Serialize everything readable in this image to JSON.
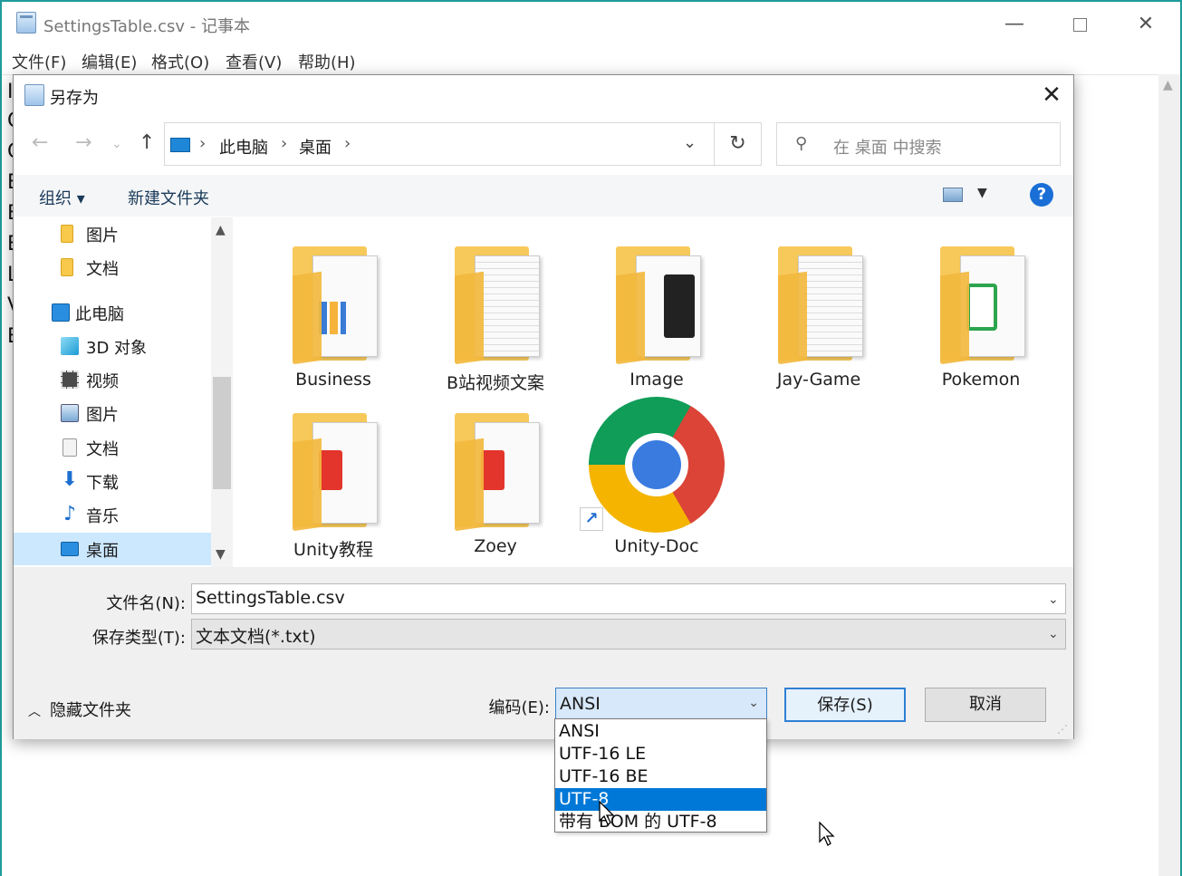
{
  "notepad": {
    "title": "SettingsTable.csv - 记事本",
    "menu": [
      "文件(F)",
      "编辑(E)",
      "格式(O)",
      "查看(V)",
      "帮助(H)"
    ],
    "line_starts": [
      "I",
      "C",
      "C",
      "E",
      "E",
      "E",
      "L",
      "V",
      "E"
    ]
  },
  "dialog": {
    "title": "另存为",
    "address": {
      "segments": [
        "此电脑",
        "桌面"
      ]
    },
    "search_placeholder": "在 桌面 中搜索",
    "toolbar": {
      "organize": "组织 ▾",
      "new_folder": "新建文件夹"
    },
    "nav_items": [
      {
        "label": "图片",
        "icon": "folder-icon"
      },
      {
        "label": "文档",
        "icon": "folder-icon"
      },
      {
        "label": "此电脑",
        "icon": "computer-icon"
      },
      {
        "label": "3D 对象",
        "icon": "3d-objects-icon"
      },
      {
        "label": "视频",
        "icon": "video-icon"
      },
      {
        "label": "图片",
        "icon": "pictures-icon"
      },
      {
        "label": "文档",
        "icon": "documents-icon"
      },
      {
        "label": "下载",
        "icon": "download-icon"
      },
      {
        "label": "音乐",
        "icon": "music-icon"
      },
      {
        "label": "桌面",
        "icon": "desktop-icon",
        "selected": true
      }
    ],
    "files": [
      {
        "name": "Business",
        "icon": "folder-icon"
      },
      {
        "name": "B站视频文案",
        "icon": "folder-icon"
      },
      {
        "name": "Image",
        "icon": "folder-icon"
      },
      {
        "name": "Jay-Game",
        "icon": "folder-icon"
      },
      {
        "name": "Pokemon",
        "icon": "folder-icon"
      },
      {
        "name": "Unity教程",
        "icon": "folder-icon"
      },
      {
        "name": "Zoey",
        "icon": "folder-icon"
      },
      {
        "name": "Unity-Doc",
        "icon": "chrome-shortcut-icon"
      }
    ],
    "filename_label": "文件名(N):",
    "filename_value": "SettingsTable.csv",
    "filetype_label": "保存类型(T):",
    "filetype_value": "文本文档(*.txt)",
    "hide_folders": "隐藏文件夹",
    "encoding_label": "编码(E):",
    "encoding_value": "ANSI",
    "save_button": "保存(S)",
    "cancel_button": "取消",
    "encoding_options": [
      "ANSI",
      "UTF-16 LE",
      "UTF-16 BE",
      "UTF-8",
      "带有 BOM 的 UTF-8"
    ],
    "encoding_highlighted": "UTF-8"
  },
  "colors": {
    "accent": "#0078d7",
    "help": "#1a6fd6",
    "folder": "#f7c95b"
  }
}
